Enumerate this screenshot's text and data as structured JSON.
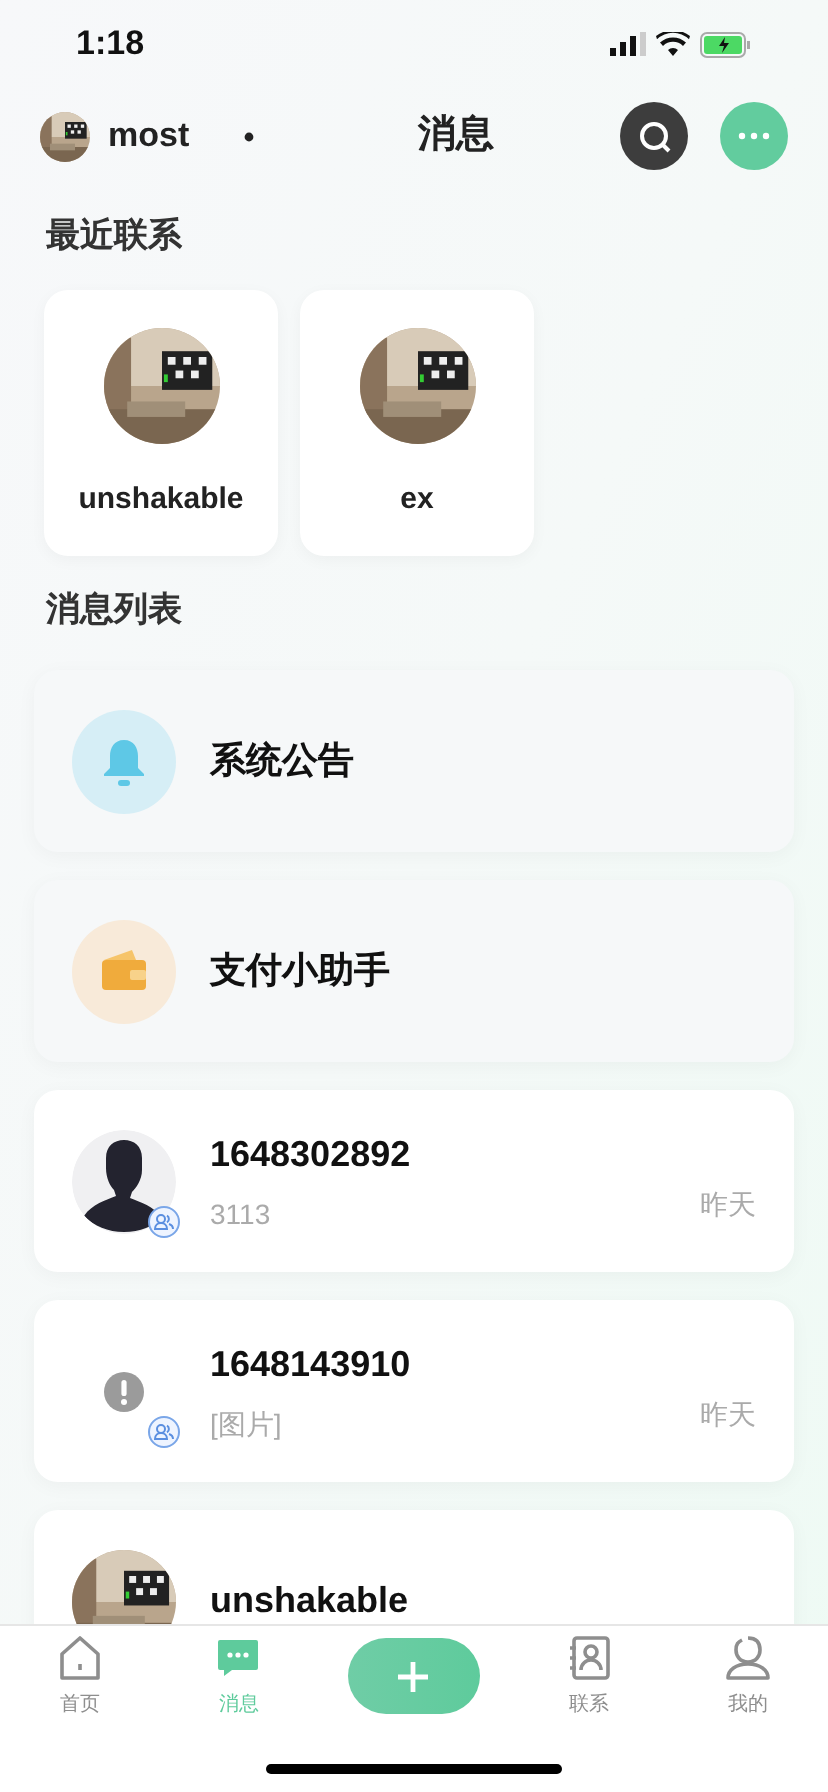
{
  "status_bar": {
    "time": "1:18"
  },
  "header": {
    "user": "most",
    "title": "消息"
  },
  "recent": {
    "title": "最近联系",
    "contacts": [
      {
        "name": "unshakable"
      },
      {
        "name": "ex"
      }
    ]
  },
  "messages": {
    "title": "消息列表",
    "items": [
      {
        "kind": "system",
        "name": "系统公告"
      },
      {
        "kind": "payment",
        "name": "支付小助手"
      },
      {
        "kind": "chat",
        "avatar": {
          "kind": "silhouette"
        },
        "group": true,
        "name": "1648302892",
        "preview": "3113",
        "time": "昨天"
      },
      {
        "kind": "chat",
        "avatar": {
          "kind": "error"
        },
        "group": true,
        "name": "1648143910",
        "preview": "[图片]",
        "time": "昨天"
      },
      {
        "kind": "chat",
        "name": "unshakable"
      }
    ]
  },
  "tab_bar": [
    {
      "kind": "home",
      "label": "首页",
      "selected": false
    },
    {
      "kind": "messages",
      "label": "消息",
      "selected": true
    },
    {
      "kind": "add"
    },
    {
      "kind": "contacts",
      "label": "联系",
      "selected": false
    },
    {
      "kind": "profile",
      "label": "我的",
      "selected": false
    }
  ]
}
